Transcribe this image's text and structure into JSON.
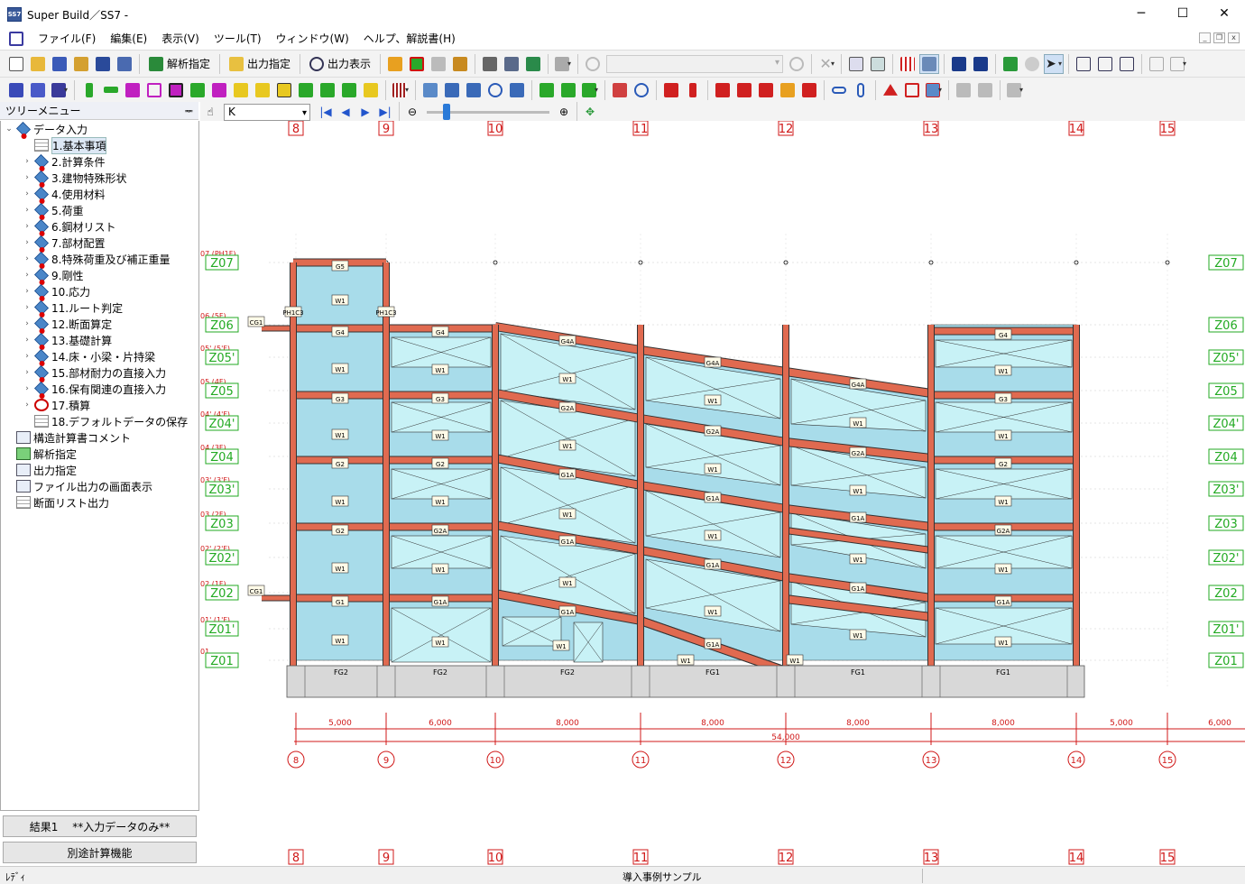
{
  "window": {
    "app_icon_text": "SS7",
    "title": "Super Build／SS7 -",
    "min_glyph": "─",
    "max_glyph": "☐",
    "close_glyph": "✕"
  },
  "menubar": {
    "items": [
      "ファイル(F)",
      "編集(E)",
      "表示(V)",
      "ツール(T)",
      "ウィンドウ(W)",
      "ヘルプ、解説書(H)"
    ]
  },
  "mdi": {
    "min": "_",
    "restore": "❐",
    "close": "x"
  },
  "toolbar1": {
    "analysis_label": "解析指定",
    "output_label": "出力指定",
    "output_view_label": "出力表示"
  },
  "tree": {
    "header": "ツリーメニュー",
    "pin": "ᆓ",
    "root": "データ入力",
    "items": [
      {
        "label": "1.基本事項",
        "icon": "table-icon",
        "selected": true
      },
      {
        "label": "2.計算条件",
        "icon": "diamond-icon"
      },
      {
        "label": "3.建物特殊形状",
        "icon": "diamond-icon"
      },
      {
        "label": "4.使用材料",
        "icon": "diamond-icon"
      },
      {
        "label": "5.荷重",
        "icon": "diamond-icon"
      },
      {
        "label": "6.鋼材リスト",
        "icon": "diamond-icon"
      },
      {
        "label": "7.部材配置",
        "icon": "diamond-icon"
      },
      {
        "label": "8.特殊荷重及び補正重量",
        "icon": "diamond-icon"
      },
      {
        "label": "9.剛性",
        "icon": "diamond-icon"
      },
      {
        "label": "10.応力",
        "icon": "diamond-icon"
      },
      {
        "label": "11.ルート判定",
        "icon": "diamond-icon"
      },
      {
        "label": "12.断面算定",
        "icon": "diamond-icon"
      },
      {
        "label": "13.基礎計算",
        "icon": "diamond-icon"
      },
      {
        "label": "14.床・小梁・片持梁",
        "icon": "diamond-icon"
      },
      {
        "label": "15.部材耐力の直接入力",
        "icon": "diamond-icon"
      },
      {
        "label": "16.保有関連の直接入力",
        "icon": "diamond-icon"
      },
      {
        "label": "17.積算",
        "icon": "no-entry-icon"
      },
      {
        "label": "18.デフォルトデータの保存",
        "icon": "table-icon"
      }
    ],
    "others": [
      "構造計算書コメント",
      "解析指定",
      "出力指定",
      "ファイル出力の画面表示",
      "断面リスト出力"
    ],
    "result_button": "結果1　 **入力データのみ**",
    "separate_button": "別途計算機能"
  },
  "nav": {
    "frame_value": "K",
    "first": "|◀",
    "prev": "◀",
    "next": "▶",
    "last": "▶|"
  },
  "drawing": {
    "col_axes": [
      "8",
      "9",
      "10",
      "11",
      "12",
      "13",
      "14",
      "15"
    ],
    "levels_left": [
      {
        "label": "Z07",
        "tag": "07 (PH1F)"
      },
      {
        "label": "Z06",
        "tag": "06 (5F)"
      },
      {
        "label": "Z05'",
        "tag": "05' (5'F)"
      },
      {
        "label": "Z05",
        "tag": "05 (4F)"
      },
      {
        "label": "Z04'",
        "tag": "04' (4'F)"
      },
      {
        "label": "Z04",
        "tag": "04 (3F)"
      },
      {
        "label": "Z03'",
        "tag": "03' (3'F)"
      },
      {
        "label": "Z03",
        "tag": "03 (2F)"
      },
      {
        "label": "Z02'",
        "tag": "02' (2'F)"
      },
      {
        "label": "Z02",
        "tag": "02 (1F)"
      },
      {
        "label": "Z01'",
        "tag": "01' (1'F)"
      },
      {
        "label": "Z01",
        "tag": "01"
      }
    ],
    "levels_right": [
      "Z07",
      "Z06",
      "Z05'",
      "Z05",
      "Z04'",
      "Z04",
      "Z03'",
      "Z03",
      "Z02'",
      "Z02",
      "Z01'",
      "Z01"
    ],
    "spans": [
      "5,000",
      "6,000",
      "8,000",
      "8,000",
      "8,000",
      "8,000",
      "5,000",
      "6,000"
    ],
    "total": "54,000",
    "labels": {
      "cg": "CG1",
      "wall": "W1",
      "g5": "G5",
      "g4": "G4",
      "g3": "G3",
      "g2": "G2",
      "g2a": "G2A",
      "g1": "G1",
      "g1a": "G1A",
      "g4a": "G4A",
      "fg1": "FG1",
      "fg2": "FG2",
      "ph": "PH1C3"
    }
  },
  "status": {
    "left": "ﾚﾃﾞｨ",
    "center": "導入事例サンプル"
  },
  "colors": {
    "beam": "#e06a50",
    "panel": "#a8dcea",
    "panel_light": "#c8f2f6",
    "axis": "#d01818",
    "level": "#22aa22",
    "foundation": "#d8d8d8"
  }
}
